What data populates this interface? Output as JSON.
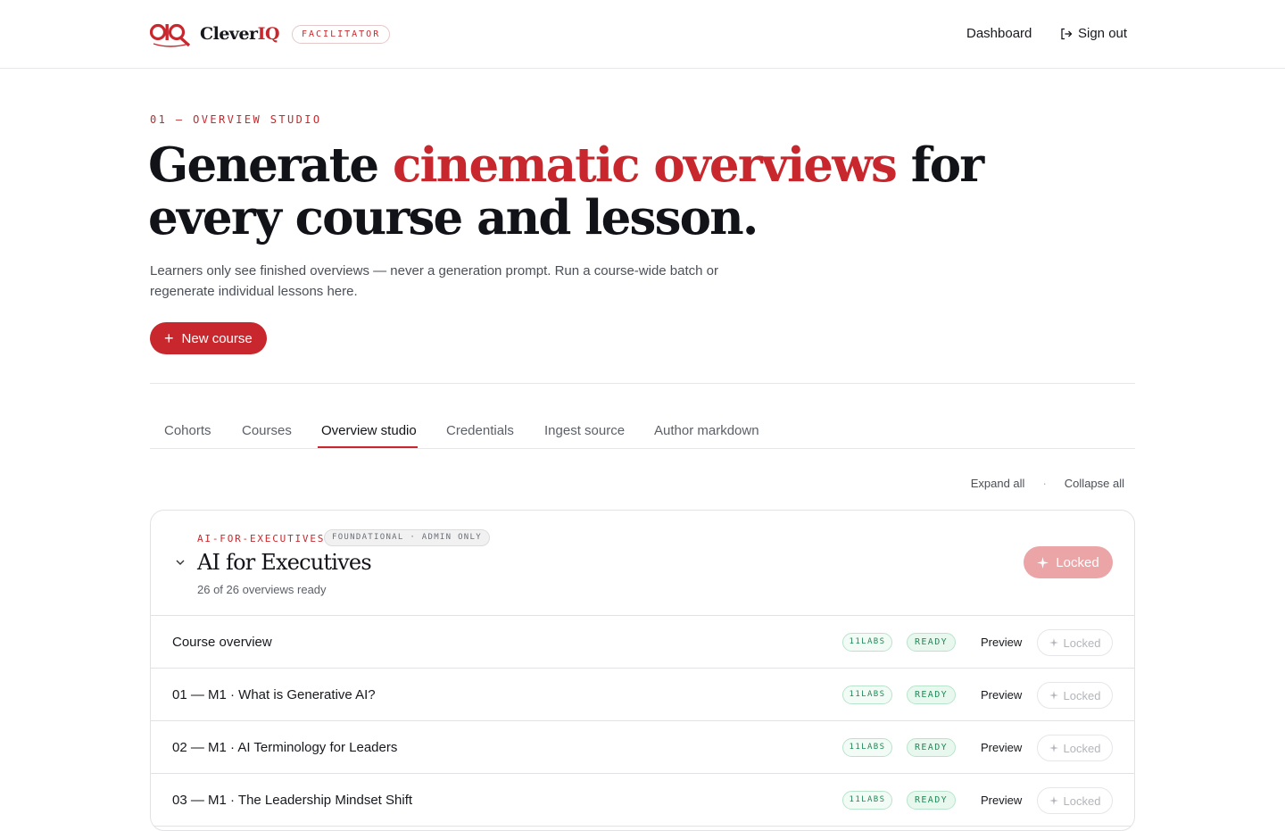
{
  "header": {
    "brand_name": "Clever",
    "brand_suffix": "IQ",
    "role_badge": "FACILITATOR",
    "nav_dashboard": "Dashboard",
    "nav_signout": "Sign out"
  },
  "hero": {
    "eyebrow": "01 — OVERVIEW STUDIO",
    "title_pre": "Generate ",
    "title_accent": "cinematic overviews",
    "title_post": " for every course and lesson.",
    "description": "Learners only see finished overviews — never a generation prompt. Run a course-wide batch or regenerate individual lessons here.",
    "new_course_label": "New course"
  },
  "tabs": [
    {
      "label": "Cohorts"
    },
    {
      "label": "Courses"
    },
    {
      "label": "Overview studio",
      "active": true
    },
    {
      "label": "Credentials"
    },
    {
      "label": "Ingest source"
    },
    {
      "label": "Author markdown"
    }
  ],
  "controls": {
    "expand_all": "Expand all",
    "collapse_all": "Collapse all"
  },
  "course": {
    "slug": "AI-FOR-EXECUTIVES",
    "tag": "FOUNDATIONAL · ADMIN ONLY",
    "title": "AI for Executives",
    "count": "26 of 26 overviews ready",
    "action_label": "Locked",
    "lessons": [
      {
        "title": "Course overview",
        "provider": "11LABS",
        "status": "READY",
        "preview": "Preview",
        "action": "Locked"
      },
      {
        "title": "01 — M1 · What is Generative AI?",
        "provider": "11LABS",
        "status": "READY",
        "preview": "Preview",
        "action": "Locked"
      },
      {
        "title": "02 — M1 · AI Terminology for Leaders",
        "provider": "11LABS",
        "status": "READY",
        "preview": "Preview",
        "action": "Locked"
      },
      {
        "title": "03 — M1 · The Leadership Mindset Shift",
        "provider": "11LABS",
        "status": "READY",
        "preview": "Preview",
        "action": "Locked"
      }
    ]
  },
  "colors": {
    "accent": "#c8282d",
    "ready_green": "#1f8a55",
    "locked_disabled": "#eba5a7"
  }
}
